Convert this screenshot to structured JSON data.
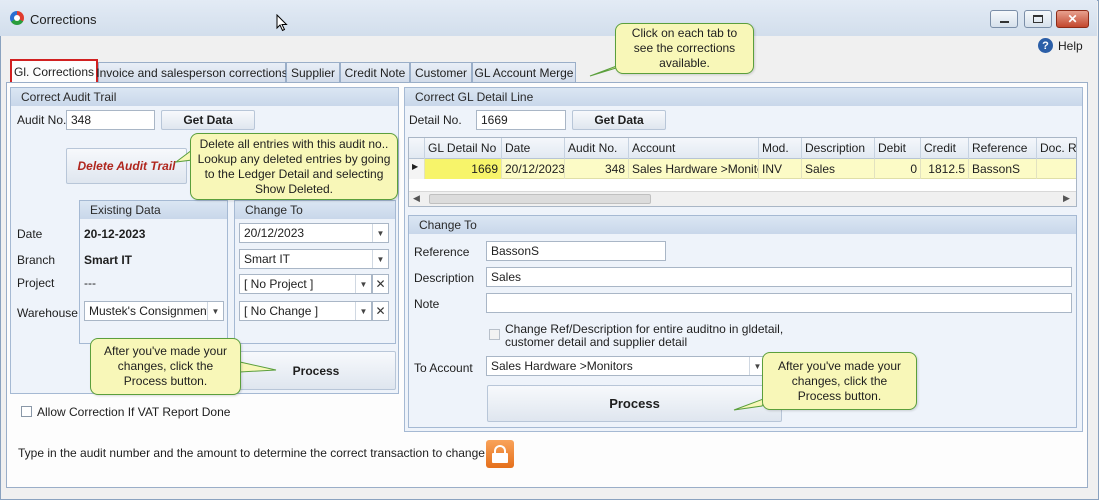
{
  "window": {
    "title": "Corrections",
    "help_label": "Help"
  },
  "tabs": [
    {
      "label": "Gl. Corrections",
      "active": true
    },
    {
      "label": "Invoice and salesperson corrections"
    },
    {
      "label": "Supplier"
    },
    {
      "label": "Credit Note"
    },
    {
      "label": "Customer"
    },
    {
      "label": "GL Account Merge"
    }
  ],
  "tips": {
    "tabs": "Click on each tab to see the corrections available.",
    "delete": "Delete all entries with this audit no.. Lookup any deleted entries by going to the Ledger Detail and selecting Show Deleted.",
    "process_left": "After you've made your changes, click the Process button.",
    "process_right": "After you've made your changes, click the Process button."
  },
  "audit_trail": {
    "title": "Correct Audit Trail",
    "audit_label": "Audit No.",
    "audit_value": "348",
    "get_data": "Get Data",
    "delete_button": "Delete Audit Trail",
    "existing_header": "Existing Data",
    "change_header": "Change To",
    "rows": [
      {
        "label": "Date",
        "existing": "20-12-2023",
        "change": "20/12/2023"
      },
      {
        "label": "Branch",
        "existing": "Smart IT",
        "change": "Smart IT"
      },
      {
        "label": "Project",
        "existing": "---",
        "change": "[ No Project ]"
      },
      {
        "label": "Warehouse",
        "existing": "Mustek's Consignment...",
        "change": "[ No Change ]"
      }
    ],
    "process": "Process"
  },
  "allow_vat": "Allow Correction If VAT Report Done",
  "footer_hint": "Type in the audit number and the amount to determine the correct transaction to change",
  "gl_detail": {
    "title": "Correct GL Detail Line",
    "detail_label": "Detail No.",
    "detail_value": "1669",
    "get_data": "Get Data",
    "columns": [
      "GL Detail No",
      "Date",
      "Audit No.",
      "Account",
      "Mod.",
      "Description",
      "Debit",
      "Credit",
      "Reference",
      "Doc. Re"
    ],
    "row": [
      "1669",
      "20/12/2023",
      "348",
      "Sales Hardware >Monitors",
      "INV",
      "Sales",
      "0",
      "1812.5",
      "BassonS",
      ""
    ]
  },
  "change_to": {
    "title": "Change To",
    "reference_label": "Reference",
    "reference_value": "BassonS",
    "description_label": "Description",
    "description_value": "Sales",
    "note_label": "Note",
    "note_value": "",
    "checkbox_label_1": "Change Ref/Description for entire auditno in gldetail,",
    "checkbox_label_2": "customer detail and supplier detail",
    "account_label": "To Account",
    "account_value": "Sales Hardware >Monitors",
    "process": "Process"
  }
}
